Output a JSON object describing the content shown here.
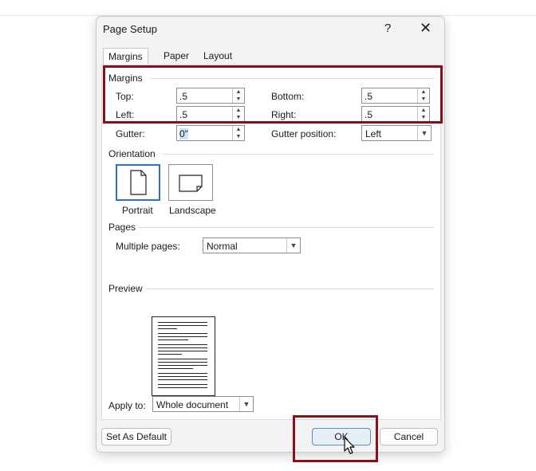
{
  "dialog": {
    "title": "Page Setup",
    "help_glyph": "?",
    "close_glyph": "✕"
  },
  "tabs": [
    {
      "label": "Margins",
      "active": true
    },
    {
      "label": "Paper",
      "active": false
    },
    {
      "label": "Layout",
      "active": false
    }
  ],
  "margins": {
    "section_label": "Margins",
    "top": {
      "label": "Top:",
      "value": ".5"
    },
    "bottom": {
      "label": "Bottom:",
      "value": ".5"
    },
    "left": {
      "label": "Left:",
      "value": ".5"
    },
    "right": {
      "label": "Right:",
      "value": ".5"
    },
    "gutter": {
      "label": "Gutter:",
      "value": "0\""
    },
    "gutter_position": {
      "label": "Gutter position:",
      "value": "Left"
    }
  },
  "orientation": {
    "section_label": "Orientation",
    "portrait_label": "Portrait",
    "landscape_label": "Landscape",
    "selected": "Portrait"
  },
  "pages": {
    "section_label": "Pages",
    "multiple_label": "Multiple pages:",
    "multiple_value": "Normal"
  },
  "preview": {
    "section_label": "Preview"
  },
  "apply": {
    "label": "Apply to:",
    "value": "Whole document"
  },
  "buttons": {
    "default_label": "Set As Default",
    "ok_label": "OK",
    "cancel_label": "Cancel"
  },
  "colors": {
    "highlight": "#8b0e18",
    "focus_blue": "#2b73c4"
  }
}
